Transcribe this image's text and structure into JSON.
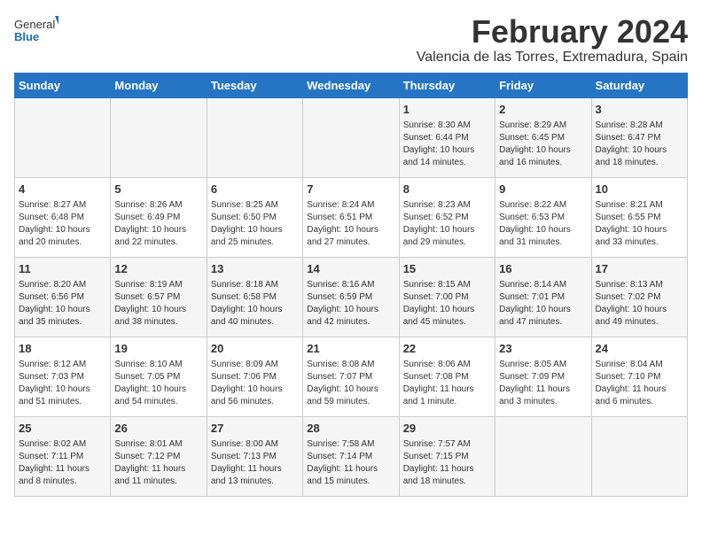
{
  "header": {
    "logo_general": "General",
    "logo_blue": "Blue",
    "month_title": "February 2024",
    "location": "Valencia de las Torres, Extremadura, Spain"
  },
  "calendar": {
    "days_of_week": [
      "Sunday",
      "Monday",
      "Tuesday",
      "Wednesday",
      "Thursday",
      "Friday",
      "Saturday"
    ],
    "weeks": [
      [
        {
          "day": "",
          "info": ""
        },
        {
          "day": "",
          "info": ""
        },
        {
          "day": "",
          "info": ""
        },
        {
          "day": "",
          "info": ""
        },
        {
          "day": "1",
          "info": "Sunrise: 8:30 AM\nSunset: 6:44 PM\nDaylight: 10 hours\nand 14 minutes."
        },
        {
          "day": "2",
          "info": "Sunrise: 8:29 AM\nSunset: 6:45 PM\nDaylight: 10 hours\nand 16 minutes."
        },
        {
          "day": "3",
          "info": "Sunrise: 8:28 AM\nSunset: 6:47 PM\nDaylight: 10 hours\nand 18 minutes."
        }
      ],
      [
        {
          "day": "4",
          "info": "Sunrise: 8:27 AM\nSunset: 6:48 PM\nDaylight: 10 hours\nand 20 minutes."
        },
        {
          "day": "5",
          "info": "Sunrise: 8:26 AM\nSunset: 6:49 PM\nDaylight: 10 hours\nand 22 minutes."
        },
        {
          "day": "6",
          "info": "Sunrise: 8:25 AM\nSunset: 6:50 PM\nDaylight: 10 hours\nand 25 minutes."
        },
        {
          "day": "7",
          "info": "Sunrise: 8:24 AM\nSunset: 6:51 PM\nDaylight: 10 hours\nand 27 minutes."
        },
        {
          "day": "8",
          "info": "Sunrise: 8:23 AM\nSunset: 6:52 PM\nDaylight: 10 hours\nand 29 minutes."
        },
        {
          "day": "9",
          "info": "Sunrise: 8:22 AM\nSunset: 6:53 PM\nDaylight: 10 hours\nand 31 minutes."
        },
        {
          "day": "10",
          "info": "Sunrise: 8:21 AM\nSunset: 6:55 PM\nDaylight: 10 hours\nand 33 minutes."
        }
      ],
      [
        {
          "day": "11",
          "info": "Sunrise: 8:20 AM\nSunset: 6:56 PM\nDaylight: 10 hours\nand 35 minutes."
        },
        {
          "day": "12",
          "info": "Sunrise: 8:19 AM\nSunset: 6:57 PM\nDaylight: 10 hours\nand 38 minutes."
        },
        {
          "day": "13",
          "info": "Sunrise: 8:18 AM\nSunset: 6:58 PM\nDaylight: 10 hours\nand 40 minutes."
        },
        {
          "day": "14",
          "info": "Sunrise: 8:16 AM\nSunset: 6:59 PM\nDaylight: 10 hours\nand 42 minutes."
        },
        {
          "day": "15",
          "info": "Sunrise: 8:15 AM\nSunset: 7:00 PM\nDaylight: 10 hours\nand 45 minutes."
        },
        {
          "day": "16",
          "info": "Sunrise: 8:14 AM\nSunset: 7:01 PM\nDaylight: 10 hours\nand 47 minutes."
        },
        {
          "day": "17",
          "info": "Sunrise: 8:13 AM\nSunset: 7:02 PM\nDaylight: 10 hours\nand 49 minutes."
        }
      ],
      [
        {
          "day": "18",
          "info": "Sunrise: 8:12 AM\nSunset: 7:03 PM\nDaylight: 10 hours\nand 51 minutes."
        },
        {
          "day": "19",
          "info": "Sunrise: 8:10 AM\nSunset: 7:05 PM\nDaylight: 10 hours\nand 54 minutes."
        },
        {
          "day": "20",
          "info": "Sunrise: 8:09 AM\nSunset: 7:06 PM\nDaylight: 10 hours\nand 56 minutes."
        },
        {
          "day": "21",
          "info": "Sunrise: 8:08 AM\nSunset: 7:07 PM\nDaylight: 10 hours\nand 59 minutes."
        },
        {
          "day": "22",
          "info": "Sunrise: 8:06 AM\nSunset: 7:08 PM\nDaylight: 11 hours\nand 1 minute."
        },
        {
          "day": "23",
          "info": "Sunrise: 8:05 AM\nSunset: 7:09 PM\nDaylight: 11 hours\nand 3 minutes."
        },
        {
          "day": "24",
          "info": "Sunrise: 8:04 AM\nSunset: 7:10 PM\nDaylight: 11 hours\nand 6 minutes."
        }
      ],
      [
        {
          "day": "25",
          "info": "Sunrise: 8:02 AM\nSunset: 7:11 PM\nDaylight: 11 hours\nand 8 minutes."
        },
        {
          "day": "26",
          "info": "Sunrise: 8:01 AM\nSunset: 7:12 PM\nDaylight: 11 hours\nand 11 minutes."
        },
        {
          "day": "27",
          "info": "Sunrise: 8:00 AM\nSunset: 7:13 PM\nDaylight: 11 hours\nand 13 minutes."
        },
        {
          "day": "28",
          "info": "Sunrise: 7:58 AM\nSunset: 7:14 PM\nDaylight: 11 hours\nand 15 minutes."
        },
        {
          "day": "29",
          "info": "Sunrise: 7:57 AM\nSunset: 7:15 PM\nDaylight: 11 hours\nand 18 minutes."
        },
        {
          "day": "",
          "info": ""
        },
        {
          "day": "",
          "info": ""
        }
      ]
    ]
  }
}
